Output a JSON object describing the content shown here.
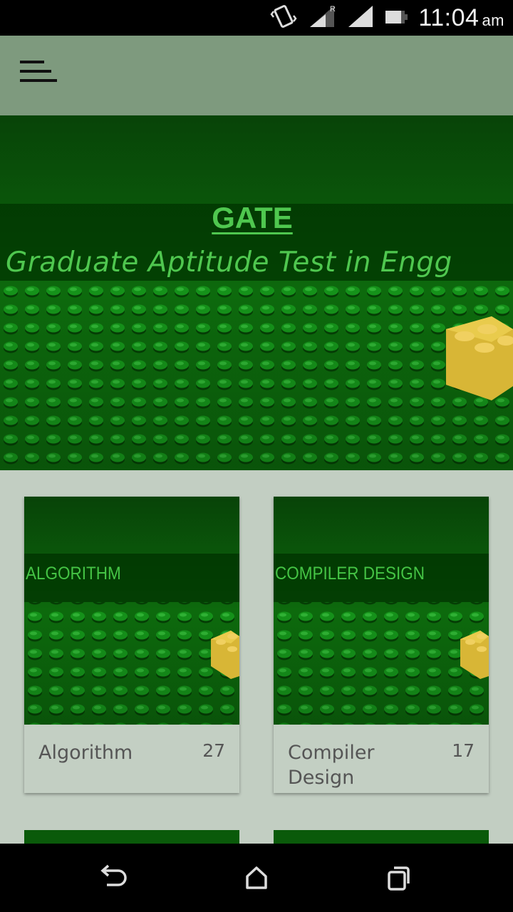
{
  "status_bar": {
    "time": "11:04",
    "ampm": "am",
    "roaming_indicator": "R",
    "icons": [
      "vibrate-icon",
      "signal-icon",
      "roaming-signal-icon",
      "battery-icon"
    ]
  },
  "app_bar": {
    "menu_icon": "hamburger-menu-icon"
  },
  "hero": {
    "title": "GATE",
    "subtitle": "Graduate Aptitude Test in Engg"
  },
  "cards": [
    {
      "banner": "ALGORITHM",
      "title": "Algorithm",
      "count": "27"
    },
    {
      "banner": "COMPILER DESIGN",
      "title": "Compiler Design",
      "count": "17"
    }
  ],
  "nav_bar": {
    "icons": [
      "back-icon",
      "home-icon",
      "recent-apps-icon"
    ]
  },
  "colors": {
    "app_bar": "#7e9a7e",
    "background": "#c2cec2",
    "banner_text": "#4fc74f",
    "lego_green": "#0a6a0a"
  }
}
